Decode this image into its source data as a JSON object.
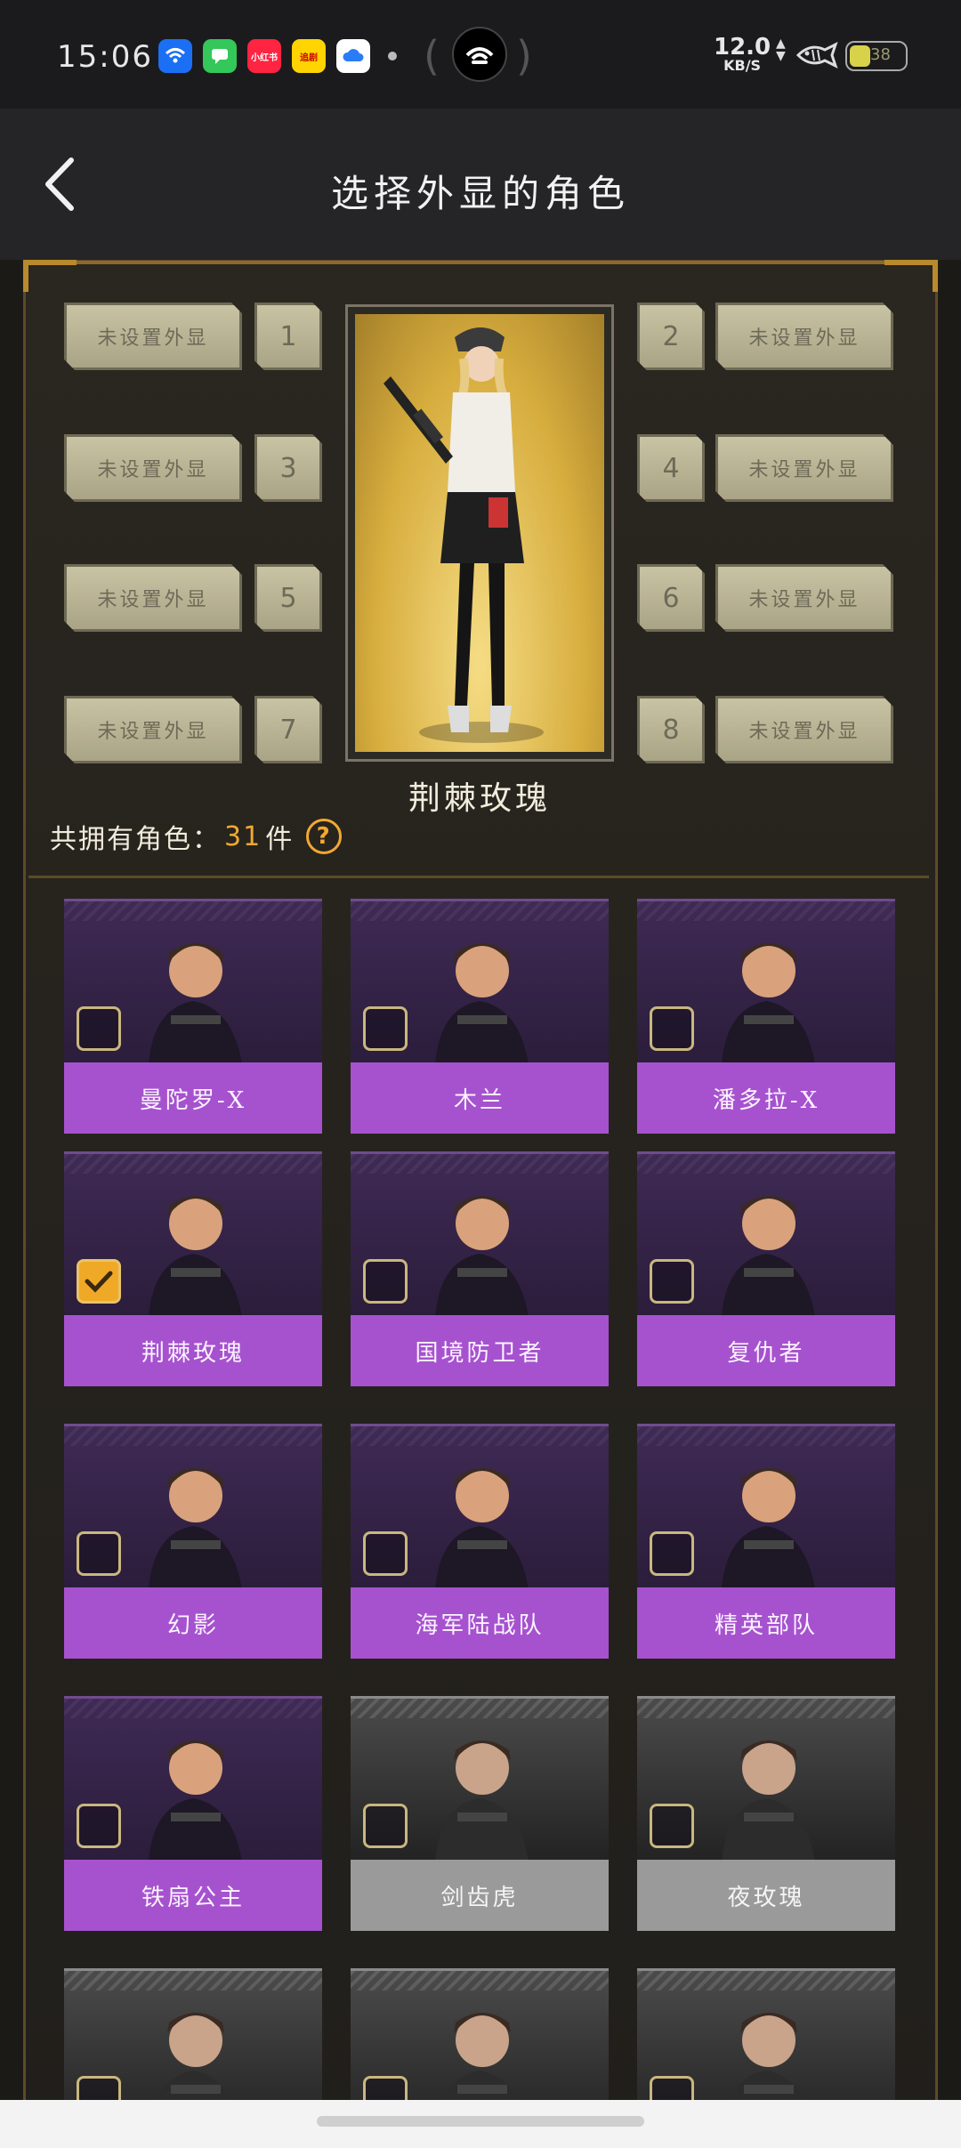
{
  "status_bar": {
    "time": "15:06",
    "apps": [
      {
        "icon": "wifi-app-icon",
        "color": "#1b6ff5",
        "text": ""
      },
      {
        "icon": "message-app-icon",
        "color": "#34c759",
        "text": ""
      },
      {
        "icon": "xiaohongshu-app-icon",
        "color": "#ff2442",
        "text": "小红书"
      },
      {
        "icon": "pudding-app-icon",
        "color": "#ffd400",
        "text": "追剧"
      },
      {
        "icon": "cloud-app-icon",
        "color": "#ffffff",
        "text": ""
      }
    ],
    "net_speed_value": "12.0",
    "net_speed_unit": "KB/S",
    "battery": "38",
    "battery_level": 0.38
  },
  "header": {
    "title": "选择外显的角色"
  },
  "slots": {
    "empty_label": "未设置外显",
    "numbers": [
      "1",
      "2",
      "3",
      "4",
      "5",
      "6",
      "7",
      "8"
    ]
  },
  "featured": {
    "name": "荆棘玫瑰"
  },
  "owned": {
    "prefix": "共拥有角色：",
    "count": "31",
    "suffix": "件",
    "help": "?"
  },
  "characters": [
    {
      "name": "曼陀罗-X",
      "style": "purple",
      "checked": false,
      "icon": "redhead-soldier-icon"
    },
    {
      "name": "木兰",
      "style": "purple",
      "checked": false,
      "icon": "mulan-soldier-icon"
    },
    {
      "name": "潘多拉-X",
      "style": "purple",
      "checked": false,
      "icon": "pandora-soldier-icon"
    },
    {
      "name": "荆棘玫瑰",
      "style": "purple",
      "checked": true,
      "icon": "thorn-rose-soldier-icon"
    },
    {
      "name": "国境防卫者",
      "style": "purple",
      "checked": false,
      "icon": "border-guard-soldier-icon"
    },
    {
      "name": "复仇者",
      "style": "purple",
      "checked": false,
      "icon": "avenger-soldier-icon"
    },
    {
      "name": "幻影",
      "style": "purple",
      "checked": false,
      "icon": "phantom-soldier-icon"
    },
    {
      "name": "海军陆战队",
      "style": "purple",
      "checked": false,
      "icon": "marine-soldier-icon"
    },
    {
      "name": "精英部队",
      "style": "purple",
      "checked": false,
      "icon": "elite-soldier-icon"
    },
    {
      "name": "铁扇公主",
      "style": "purple",
      "checked": false,
      "icon": "iron-fan-princess-icon"
    },
    {
      "name": "剑齿虎",
      "style": "grey",
      "checked": false,
      "icon": "sabretooth-soldier-icon"
    },
    {
      "name": "夜玫瑰",
      "style": "grey",
      "checked": false,
      "icon": "night-rose-soldier-icon"
    },
    {
      "name": "",
      "style": "grey",
      "checked": false,
      "icon": "beanie-soldier-icon"
    },
    {
      "name": "",
      "style": "grey",
      "checked": false,
      "icon": "hooded-soldier-icon"
    },
    {
      "name": "",
      "style": "grey",
      "checked": false,
      "icon": "goggles-soldier-icon"
    }
  ],
  "colors": {
    "accent_orange": "#f2a832",
    "card_purple": "#a652cf",
    "card_grey": "#9a9a9a",
    "gold_border": "#b98a2c"
  }
}
